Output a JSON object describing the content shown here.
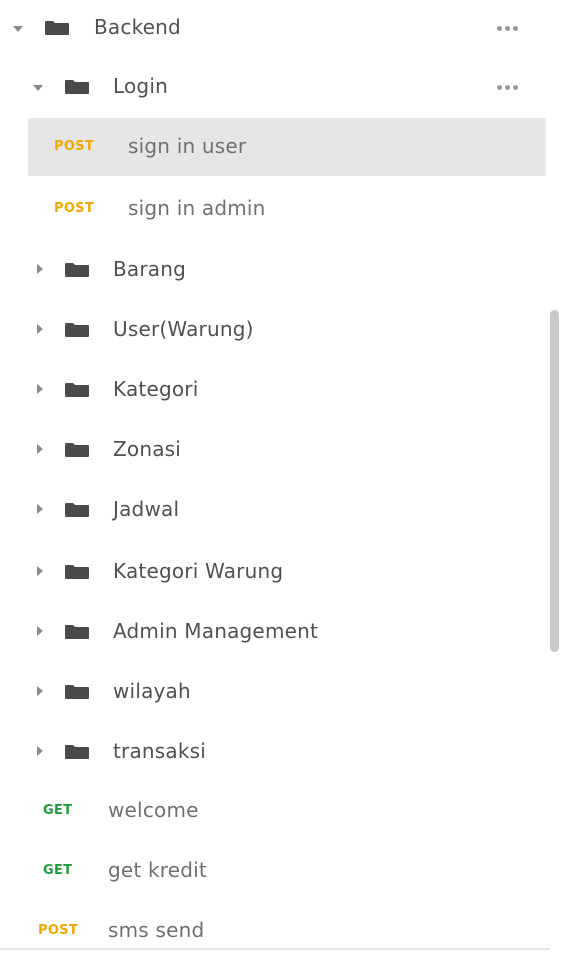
{
  "tree": {
    "root_folder": {
      "label": "Backend"
    },
    "login_folder": {
      "label": "Login"
    },
    "login_requests": [
      {
        "method": "POST",
        "label": "sign in user"
      },
      {
        "method": "POST",
        "label": "sign in admin"
      }
    ],
    "folders": [
      {
        "label": "Barang"
      },
      {
        "label": "User(Warung)"
      },
      {
        "label": "Kategori"
      },
      {
        "label": "Zonasi"
      },
      {
        "label": "Jadwal"
      },
      {
        "label": "Kategori Warung"
      },
      {
        "label": "Admin Management"
      },
      {
        "label": "wilayah"
      },
      {
        "label": "transaksi"
      }
    ],
    "root_requests": [
      {
        "method": "GET",
        "label": "welcome"
      },
      {
        "method": "GET",
        "label": "get kredit"
      },
      {
        "method": "POST",
        "label": "sms send"
      }
    ]
  },
  "colors": {
    "post": "#f5a700",
    "get": "#1f9d3a",
    "selected_bg": "#e6e6e6",
    "folder": "#4a4a4a"
  }
}
